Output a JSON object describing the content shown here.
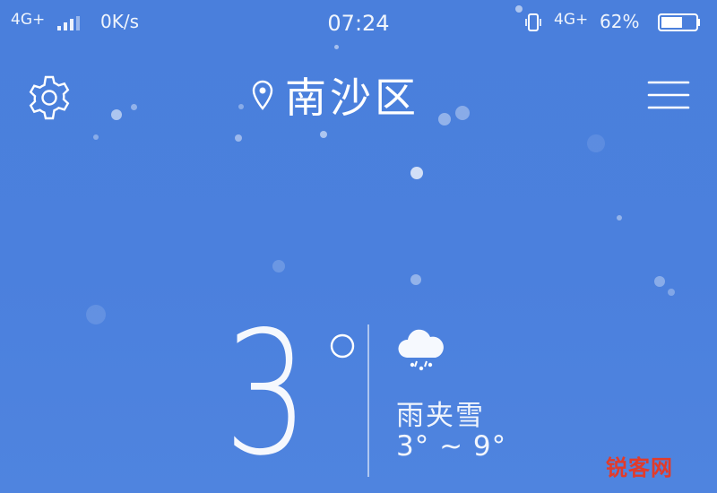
{
  "status_bar": {
    "network_left": "4G+",
    "data_speed": "0K/s",
    "time": "07:24",
    "network_right": "4G+",
    "battery_percent": "62%",
    "battery_level": 0.62
  },
  "header": {
    "location": "南沙区",
    "icons": {
      "settings": "gear-icon",
      "location": "map-pin-icon",
      "menu": "hamburger-menu-icon"
    }
  },
  "weather": {
    "current_temp": "3",
    "condition": "雨夹雪",
    "range": "3° ~ 9°",
    "condition_icon": "sleet-cloud-icon"
  },
  "watermark": "锐客网",
  "colors": {
    "background": "#4b80dd",
    "foreground": "#ffffff",
    "watermark": "#e23b2a"
  }
}
